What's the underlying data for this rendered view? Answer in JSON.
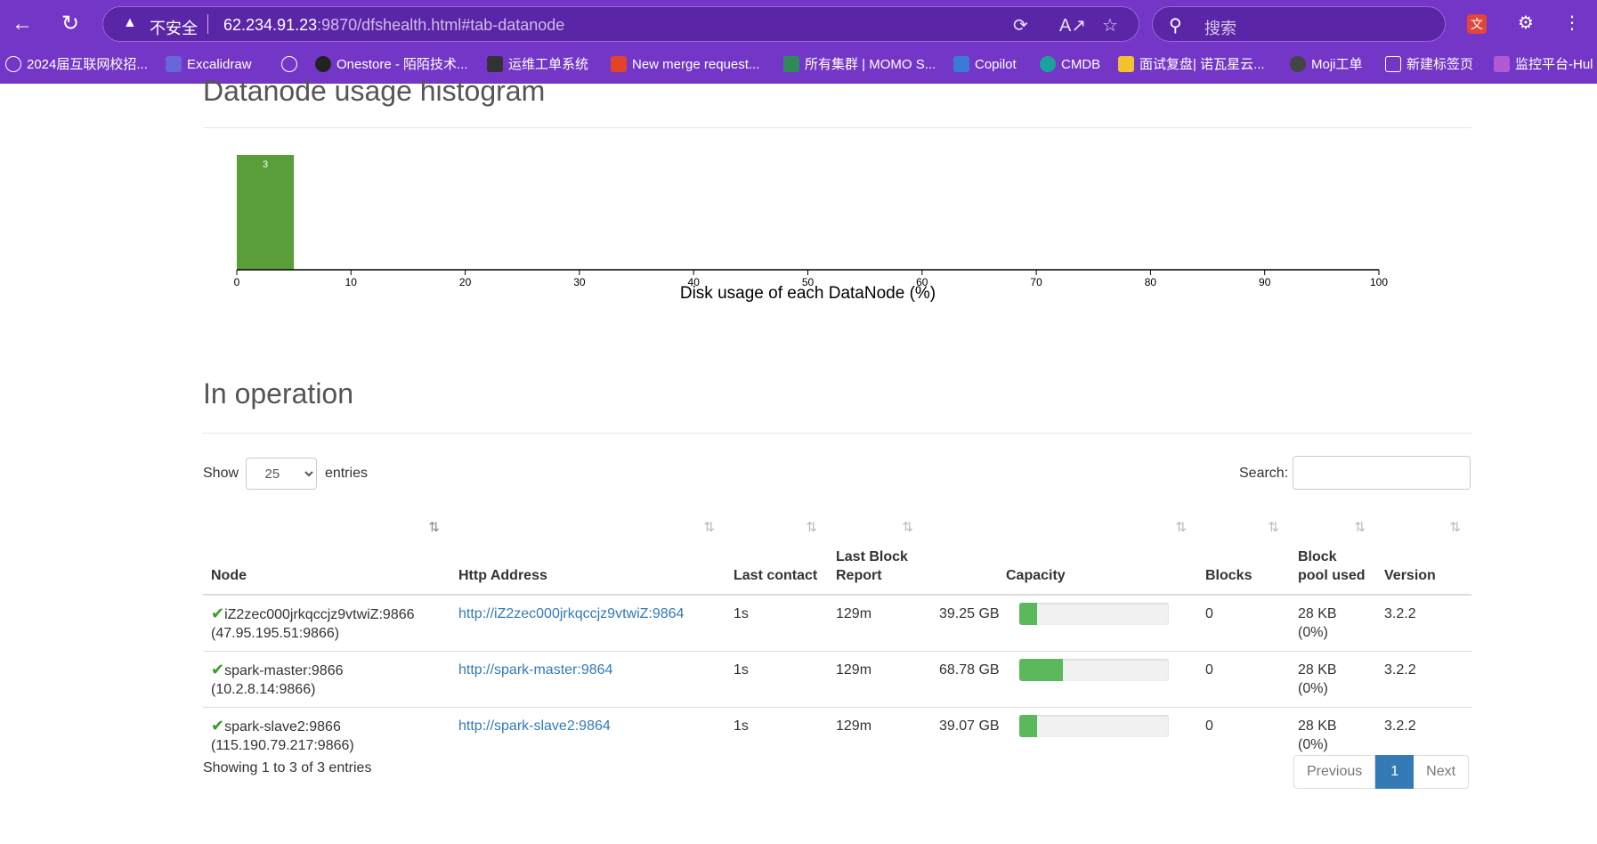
{
  "browser": {
    "insecure_label": "不安全",
    "url_host": "62.234.91.23",
    "url_rest": ":9870/dfshealth.html#tab-datanode",
    "search_placeholder": "搜索"
  },
  "bookmarks": [
    {
      "label": "2024届互联网校招...",
      "color": "#ffffff"
    },
    {
      "label": "",
      "color": "#ffffff"
    },
    {
      "label": "Excalidraw",
      "color": "#6965db"
    },
    {
      "label": "Onestore - 陌陌技术...",
      "color": "#222222"
    },
    {
      "label": "运维工单系统",
      "color": "#333333"
    },
    {
      "label": "New merge request...",
      "color": "#e24329"
    },
    {
      "label": "所有集群 | MOMO S...",
      "color": "#2e8b57"
    },
    {
      "label": "Copilot",
      "color": "#3a7bd5"
    },
    {
      "label": "CMDB",
      "color": "#1aa39a"
    },
    {
      "label": "面试复盘| 诺瓦星云...",
      "color": "#f2c230"
    },
    {
      "label": "Moji工单",
      "color": "#444444"
    },
    {
      "label": "新建标签页",
      "color": "#ffffff"
    },
    {
      "label": "监控平台-Hul",
      "color": "#b25ad6"
    }
  ],
  "histogram": {
    "title": "Datanode usage histogram",
    "xlabel": "Disk usage of each DataNode (%)"
  },
  "chart_data": {
    "type": "bar",
    "title": "Datanode usage histogram",
    "xlabel": "Disk usage of each DataNode (%)",
    "ylabel": "",
    "xlim": [
      0,
      100
    ],
    "x_ticks": [
      0,
      10,
      20,
      30,
      40,
      50,
      60,
      70,
      80,
      90,
      100
    ],
    "bins": [
      {
        "x0": 0,
        "x1": 5,
        "count": 3
      }
    ],
    "bar_color": "#5a9e3a"
  },
  "operation": {
    "title": "In operation",
    "show_label": "Show",
    "entries_value": "25",
    "entries_label": "entries",
    "search_label": "Search:",
    "columns": [
      "Node",
      "Http Address",
      "Last contact",
      "Last Block Report",
      "Capacity",
      "Blocks",
      "Block pool used",
      "Version"
    ],
    "rows": [
      {
        "node": "iZ2zec000jrkqccjz9vtwiZ:9866",
        "ip": "(47.95.195.51:9866)",
        "http": "http://iZ2zec000jrkqccjz9vtwiZ:9864",
        "last_contact": "1s",
        "last_report": "129m",
        "capacity": "39.25 GB",
        "used_fraction": 0.12,
        "blocks": "0",
        "pool_used": "28 KB (0%)",
        "version": "3.2.2"
      },
      {
        "node": "spark-master:9866",
        "ip": "(10.2.8.14:9866)",
        "http": "http://spark-master:9864",
        "last_contact": "1s",
        "last_report": "129m",
        "capacity": "68.78 GB",
        "used_fraction": 0.29,
        "blocks": "0",
        "pool_used": "28 KB (0%)",
        "version": "3.2.2"
      },
      {
        "node": "spark-slave2:9866",
        "ip": "(115.190.79.217:9866)",
        "http": "http://spark-slave2:9864",
        "last_contact": "1s",
        "last_report": "129m",
        "capacity": "39.07 GB",
        "used_fraction": 0.12,
        "blocks": "0",
        "pool_used": "28 KB (0%)",
        "version": "3.2.2"
      }
    ],
    "showing": "Showing 1 to 3 of 3 entries",
    "pager": {
      "previous": "Previous",
      "current": "1",
      "next": "Next"
    }
  }
}
